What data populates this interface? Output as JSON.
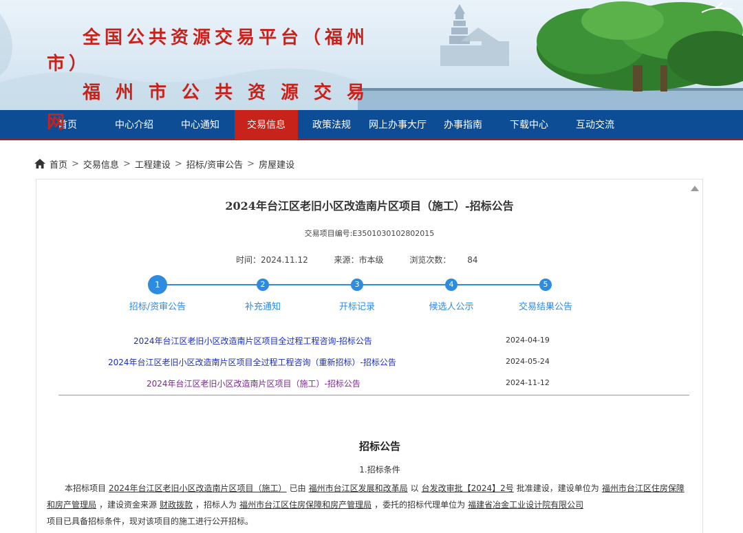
{
  "banner": {
    "title_line1": "全国公共资源交易平台（福州",
    "title_line1b": "市）",
    "title_line2": "福州市公共资源交易",
    "title_line2b": "网"
  },
  "nav": {
    "items": [
      {
        "label": "首页"
      },
      {
        "label": "中心介绍"
      },
      {
        "label": "中心通知"
      },
      {
        "label": "交易信息"
      },
      {
        "label": "政策法规"
      },
      {
        "label": "网上办事大厅"
      },
      {
        "label": "办事指南"
      },
      {
        "label": "下载中心"
      },
      {
        "label": "互动交流"
      }
    ],
    "active_index": 3
  },
  "breadcrumb": {
    "icon": "home-icon",
    "items": [
      "首页",
      "交易信息",
      "工程建设",
      "招标/资审公告",
      "房屋建设"
    ],
    "separator": ">"
  },
  "doc": {
    "title": "2024年台江区老旧小区改造南片区项目（施工）-招标公告",
    "project_no": "交易项目编号:E3501030102802015",
    "time": "时间：2024.11.12",
    "source": "来源：市本级",
    "views_label": "浏览次数：",
    "views": "84"
  },
  "steps": [
    {
      "num": "1",
      "label": "招标/资审公告"
    },
    {
      "num": "2",
      "label": "补充通知"
    },
    {
      "num": "3",
      "label": "开标记录"
    },
    {
      "num": "4",
      "label": "候选人公示"
    },
    {
      "num": "5",
      "label": "交易结果公告"
    }
  ],
  "related": [
    {
      "title": "2024年台江区老旧小区改造南片区项目全过程工程咨询-招标公告",
      "date": "2024-04-19"
    },
    {
      "title": "2024年台江区老旧小区改造南片区项目全过程工程咨询（重新招标）-招标公告",
      "date": "2024-05-24"
    },
    {
      "title": "2024年台江区老旧小区改造南片区项目（施工）-招标公告",
      "date": "2024-11-12"
    }
  ],
  "announcement": {
    "title": "招标公告",
    "section1": "1.招标条件",
    "p_prefix": "本招标项目",
    "p_project": "2024年台江区老旧小区改造南片区项目（施工）",
    "p_by": "已由",
    "p_approver": "福州市台江区发展和改革局",
    "p_with": "以",
    "p_doc": "台发改审批【2024】2号",
    "p_approved": "批准建设，建设单位为",
    "p_builder": "福州市台江区住房保障和房产管理局",
    "p_fund": "，建设资金来源",
    "p_fund_src": "财政拨款",
    "p_tenderer": "，招标人为",
    "p_tenderer_name": "福州市台江区住房保障和房产管理局",
    "p_agent": "，委托的招标代理单位为",
    "p_agent_name": "福建省冶金工业设计院有限公司",
    "p_end": "项目已具备招标条件，现对该项目的施工进行公开招标。"
  },
  "colors": {
    "nav_bg": "#0c4d96",
    "nav_active": "#c8231b",
    "title_red": "#c8231b",
    "step_blue": "#2d8ce0",
    "link_blue": "#1a2fbf",
    "link_visited": "#7a2a8f"
  }
}
